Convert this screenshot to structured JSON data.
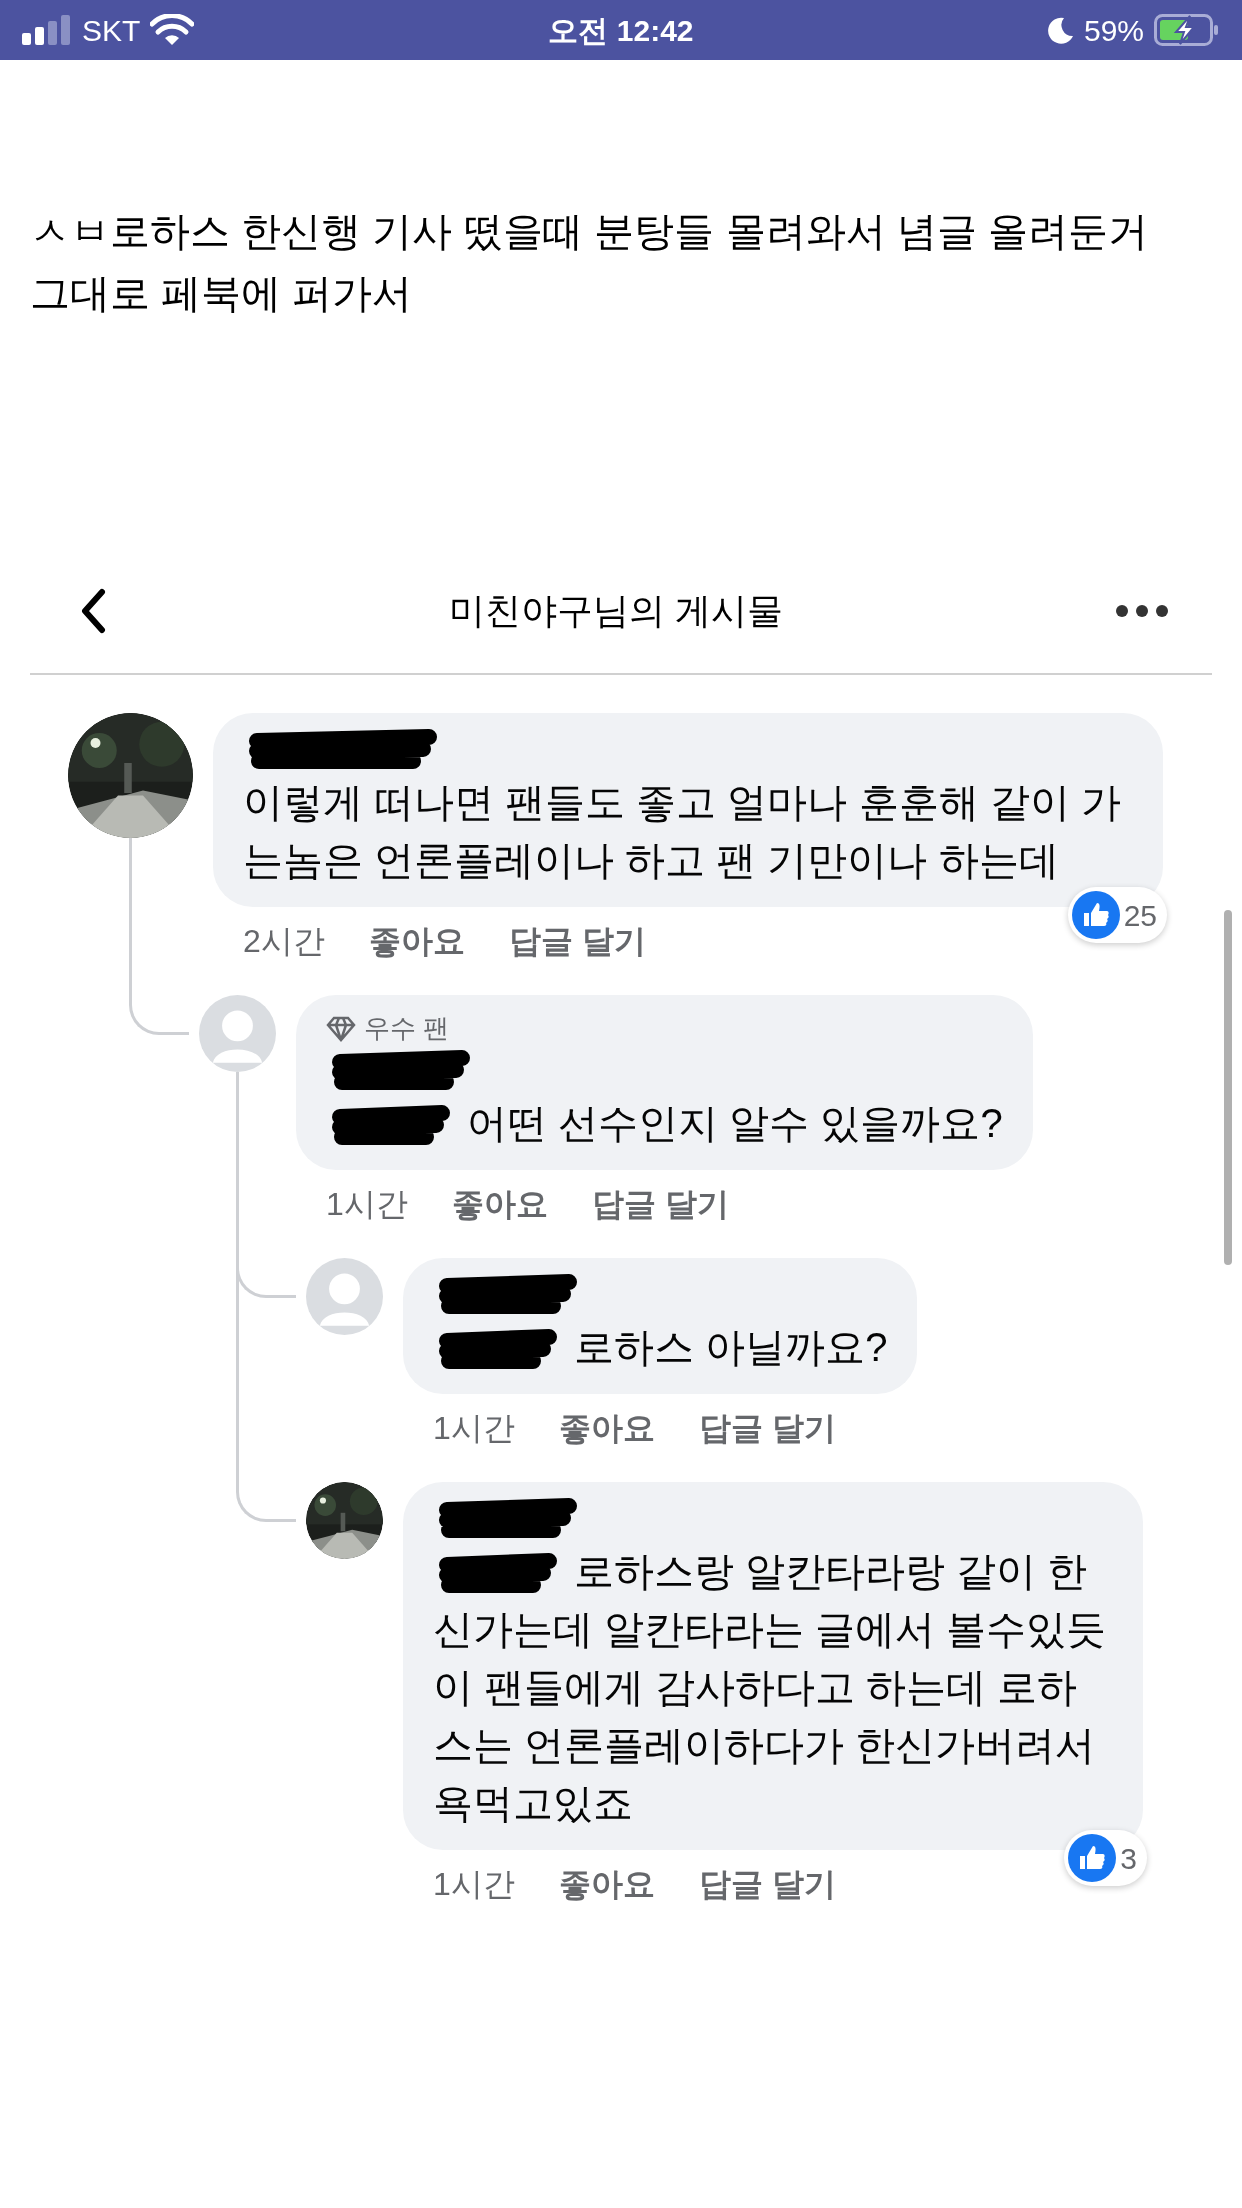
{
  "status_bar": {
    "carrier": "SKT",
    "time": "오전 12:42",
    "battery": "59%"
  },
  "post_text": "ㅅㅂ로하스 한신행 기사 떴을때 분탕들 몰려와서 념글 올려둔거 그대로 페북에 퍼가서",
  "embedded_post": {
    "title": "미친야구님의 게시물",
    "comments": [
      {
        "photo_avatar": true,
        "mention_hidden": false,
        "text": "이렇게 떠나면 팬들도 좋고 얼마나 훈훈해 같이 가는놈은 언론플레이나 하고 팬 기만이나 하는데",
        "time": "2시간",
        "like": "좋아요",
        "reply": "답글 달기",
        "reactions": "25",
        "children": [
          {
            "photo_avatar": false,
            "badge": "우수 팬",
            "mention_hidden": true,
            "text": "어떤 선수인지 알수 있을까요?",
            "time": "1시간",
            "like": "좋아요",
            "reply": "답글 달기",
            "children": [
              {
                "photo_avatar": false,
                "mention_hidden": true,
                "text": "로하스 아닐까요?",
                "time": "1시간",
                "like": "좋아요",
                "reply": "답글 달기"
              },
              {
                "photo_avatar": true,
                "mention_hidden": true,
                "text": "로하스랑 알칸타라랑 같이 한신가는데 알칸타라는 글에서 볼수있듯이 팬들에게 감사하다고 하는데 로하스는 언론플레이하다가 한신가버려서 욕먹고있죠",
                "time": "1시간",
                "like": "좋아요",
                "reply": "답글 달기",
                "reactions": "3"
              }
            ]
          }
        ]
      }
    ]
  }
}
